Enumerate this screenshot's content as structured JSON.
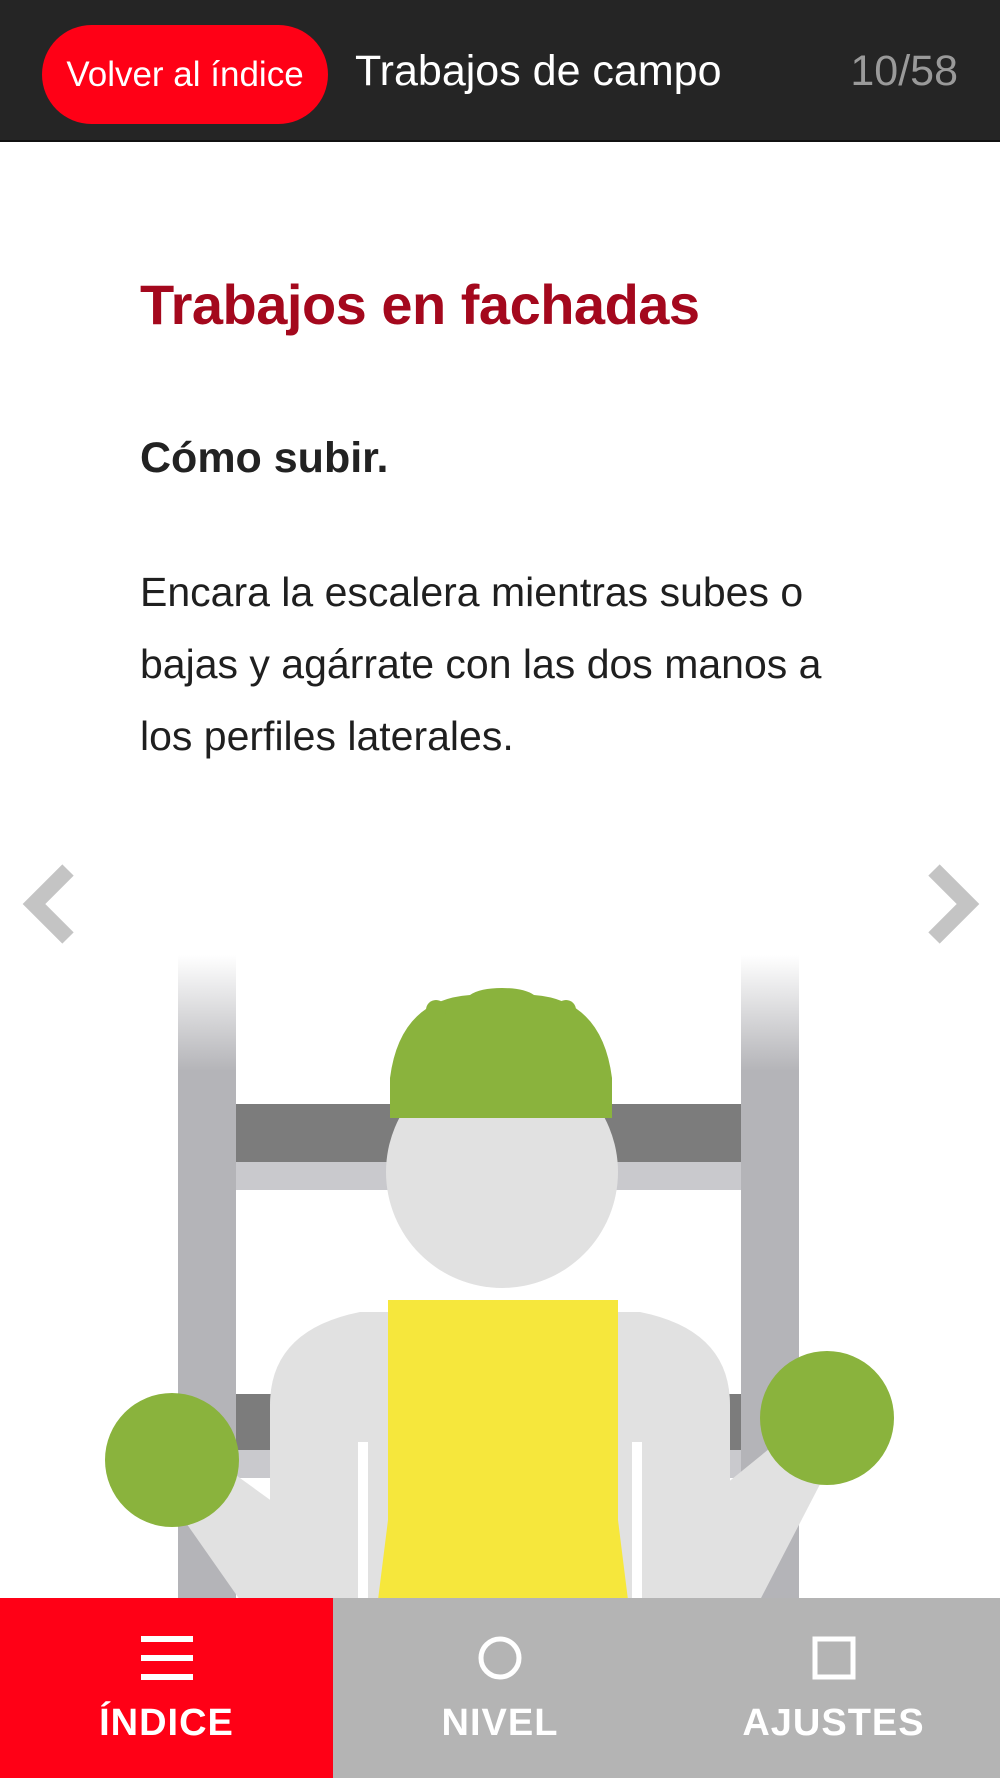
{
  "header": {
    "back_label": "Volver al índice",
    "section_title": "Trabajos de campo",
    "page_counter": "10/58"
  },
  "content": {
    "heading": "Trabajos en fachadas",
    "subheading": "Cómo subir.",
    "body": "Encara la escalera mientras subes o bajas y agárrate con las dos manos a los perfiles laterales."
  },
  "navigation": {
    "prev_icon": "chevron-left-icon",
    "next_icon": "chevron-right-icon"
  },
  "illustration": {
    "subject": "worker-climbing-ladder",
    "colors": {
      "helmet": "#8ab33d",
      "hands": "#8ab33d",
      "vest": "#f6e73c",
      "body": "#e1e1e1",
      "ladder": "#b4b4b8",
      "rung_dark": "#7c7c7c"
    }
  },
  "bottom_nav": {
    "items": [
      {
        "label": "ÍNDICE",
        "icon": "menu-icon",
        "active": true
      },
      {
        "label": "NIVEL",
        "icon": "circle-icon",
        "active": false
      },
      {
        "label": "AJUSTES",
        "icon": "square-icon",
        "active": false
      }
    ]
  },
  "colors": {
    "accent": "#ff0016",
    "heading": "#a4081d",
    "topbar": "#252525",
    "nav_inactive": "#b4b4b4"
  }
}
